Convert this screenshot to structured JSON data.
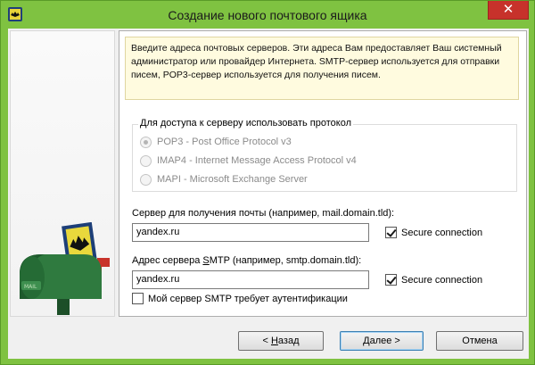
{
  "window": {
    "title": "Создание нового почтового ящика",
    "close_glyph": "✕"
  },
  "info": {
    "text": "Введите адреса почтовых серверов. Эти адреса Вам предоставляет Ваш системный администратор или провайдер Интернета. SMTP-сервер используется для отправки писем, POP3-сервер используется для получения писем."
  },
  "protocol": {
    "legend": "Для доступа к серверу использовать протокол",
    "options": [
      {
        "label": "POP3 - Post Office Protocol v3",
        "checked": true
      },
      {
        "label": "IMAP4 - Internet Message Access Protocol v4",
        "checked": false
      },
      {
        "label": "MAPI - Microsoft Exchange Server",
        "checked": false
      }
    ]
  },
  "incoming": {
    "label": "Сервер для получения почты  (например, mail.domain.tld):",
    "value": "yandex.ru",
    "secure_label": "Secure connection",
    "secure_checked": true
  },
  "outgoing": {
    "label_before": "Адрес сервера ",
    "label_accel": "S",
    "label_after": "MTP (например, smtp.domain.tld):",
    "value": "yandex.ru",
    "secure_label": "Secure connection",
    "secure_checked": true
  },
  "auth": {
    "label": "Мой сервер SMTP требует аутентификации",
    "checked": false
  },
  "buttons": {
    "back_prefix": "< ",
    "back_accel": "Н",
    "back_rest": "азад",
    "next_accel": "Д",
    "next_rest": "алее >",
    "cancel": "Отмена"
  },
  "colors": {
    "frame": "#7fc241",
    "close": "#c7322b",
    "info_bg": "#fffbdf"
  },
  "icons": {
    "app": "bat-mail-app-icon",
    "illustration": "mailbox-illustration"
  }
}
